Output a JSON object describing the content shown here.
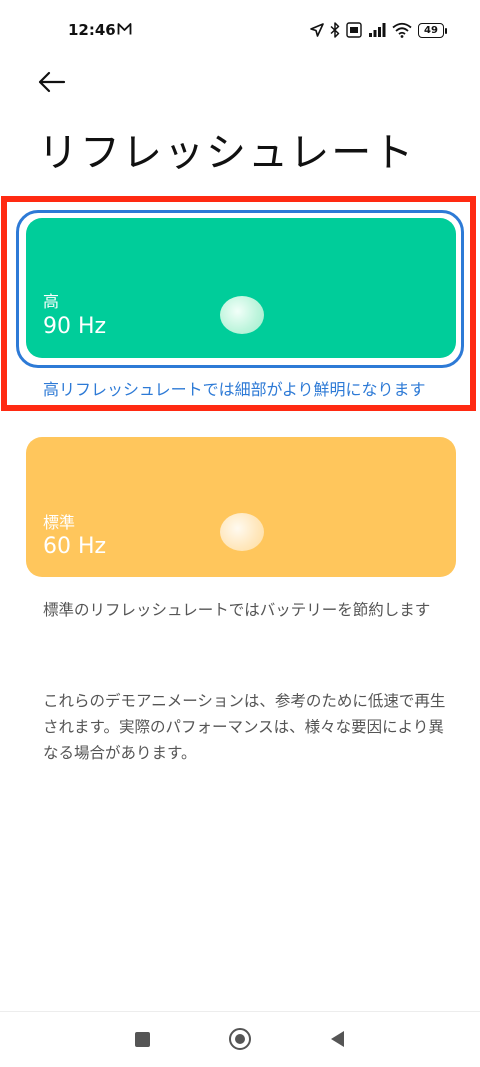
{
  "status_bar": {
    "time": "12:46",
    "battery_level": "49",
    "icons": [
      "mail-icon",
      "location-icon",
      "bluetooth-icon",
      "volte-icon",
      "signal-icon",
      "wifi-icon",
      "battery-icon"
    ]
  },
  "header": {
    "back_icon": "arrow-left-icon",
    "title": "リフレッシュレート"
  },
  "options": [
    {
      "label": "高",
      "value": "90 Hz",
      "description": "高リフレッシュレートでは細部がより鮮明になります",
      "color": "#00cd9a",
      "selected": true
    },
    {
      "label": "標準",
      "value": "60 Hz",
      "description": "標準のリフレッシュレートではバッテリーを節約します",
      "color": "#ffc65c",
      "selected": false
    }
  ],
  "note": "これらのデモアニメーションは、参考のために低速で再生されます。実際のパフォーマンスは、様々な要因により異なる場合があります。",
  "colors": {
    "highlight_frame": "#ff2a12",
    "selection_ring": "#2d7ad6",
    "accent_text": "#2d7ad6"
  },
  "nav_bar": {
    "icons": [
      "recents-square-icon",
      "home-circle-icon",
      "back-triangle-icon"
    ]
  }
}
